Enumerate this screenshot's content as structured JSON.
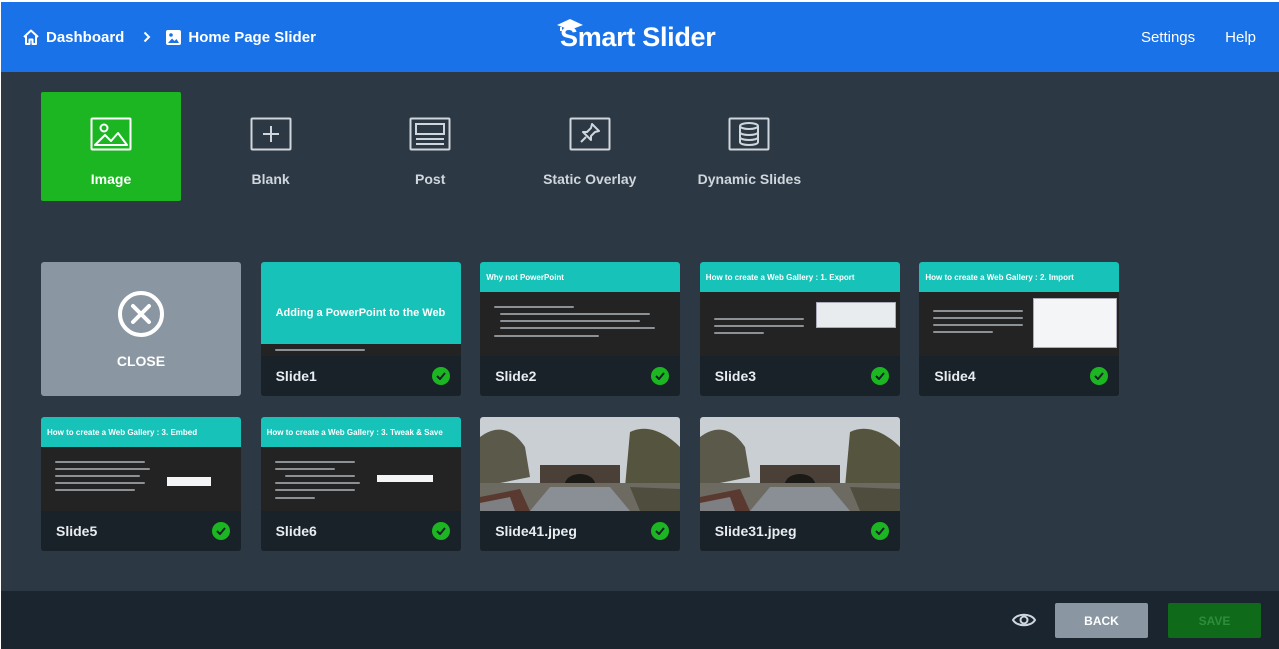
{
  "header": {
    "breadcrumb": [
      {
        "label": "Dashboard",
        "icon": "home-icon"
      },
      {
        "label": "Home Page Slider",
        "icon": "image-icon"
      }
    ],
    "logo_text": "Smart Slider",
    "links": {
      "settings": "Settings",
      "help": "Help"
    },
    "bar_color": "#1a72e8"
  },
  "slide_types": [
    {
      "label": "Image",
      "icon": "image-icon",
      "active": true
    },
    {
      "label": "Blank",
      "icon": "plus-square-icon"
    },
    {
      "label": "Post",
      "icon": "post-icon"
    },
    {
      "label": "Static Overlay",
      "icon": "pin-icon"
    },
    {
      "label": "Dynamic Slides",
      "icon": "database-icon"
    }
  ],
  "close_card": {
    "label": "CLOSE"
  },
  "slides": [
    {
      "name": "Slide1",
      "heading": "Adding a PowerPoint to the Web",
      "style": "title"
    },
    {
      "name": "Slide2",
      "heading": "Why not PowerPoint",
      "style": "bullets"
    },
    {
      "name": "Slide3",
      "heading": "How to create a Web Gallery : 1. Export",
      "style": "bullets-shot"
    },
    {
      "name": "Slide4",
      "heading": "How to create a Web Gallery : 2. Import",
      "style": "bullets-table"
    },
    {
      "name": "Slide5",
      "heading": "How to create a Web Gallery : 3. Embed",
      "style": "bullets-shot"
    },
    {
      "name": "Slide6",
      "heading": "How to create a Web Gallery : 3. Tweak & Save",
      "style": "bullets-shot"
    },
    {
      "name": "Slide41.jpeg",
      "style": "photo"
    },
    {
      "name": "Slide31.jpeg",
      "style": "photo"
    }
  ],
  "footer": {
    "back": "BACK",
    "save": "SAVE"
  },
  "colors": {
    "accent_green": "#1bb621",
    "teal": "#17c2b9",
    "panel": "#2c3843"
  }
}
